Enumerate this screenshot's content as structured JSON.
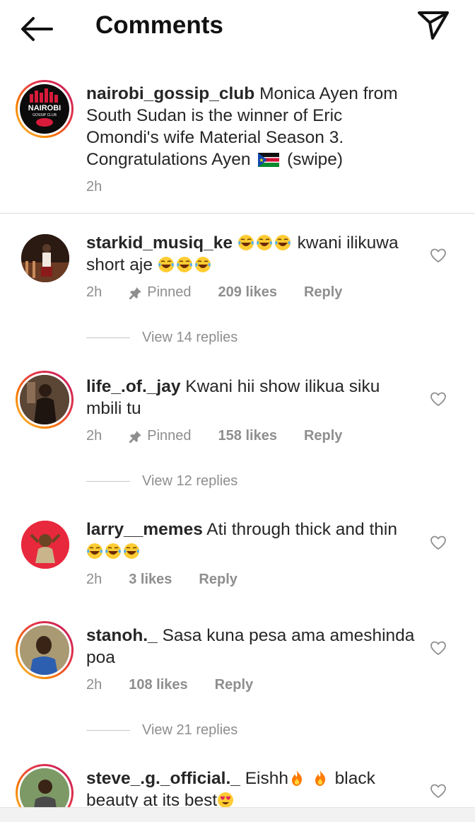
{
  "header": {
    "title": "Comments"
  },
  "caption": {
    "username": "nairobi_gossip_club",
    "text_before_flag": "Monica Ayen from South Sudan is the winner of Eric Omondi's wife Material Season 3. Congratulations Ayen",
    "text_after_flag": "(swipe)",
    "time": "2h",
    "avatar_text": "NAIROBI",
    "avatar_subtext": "GOSSIP CLUB"
  },
  "comments": [
    {
      "username": "starkid_musiq_ke",
      "text": "kwani ilikuwa short aje",
      "time": "2h",
      "pinned": "Pinned",
      "likes": "209 likes",
      "reply": "Reply",
      "view_replies": "View 14 replies"
    },
    {
      "username": "life_.of._jay",
      "text": "Kwani hii show ilikua siku mbili tu",
      "time": "2h",
      "pinned": "Pinned",
      "likes": "158 likes",
      "reply": "Reply",
      "view_replies": "View 12 replies"
    },
    {
      "username": "larry__memes",
      "text": "Ati through thick and thin",
      "time": "2h",
      "likes": "3 likes",
      "reply": "Reply"
    },
    {
      "username": "stanoh._",
      "text": "Sasa kuna pesa ama ameshinda poa",
      "time": "2h",
      "likes": "108 likes",
      "reply": "Reply",
      "view_replies": "View 21 replies"
    },
    {
      "username": "steve_.g._official._",
      "text_a": "Eishh",
      "text_b": "black beauty at its best"
    }
  ],
  "icons": {
    "back": "arrow-left-icon",
    "send": "paper-plane-icon",
    "heart": "heart-outline-icon",
    "pin": "pin-icon",
    "emoji_laugh": "face-with-tears-of-joy",
    "emoji_fire": "fire",
    "emoji_heart_eyes": "heart-eyes",
    "flag": "south-sudan-flag"
  },
  "colors": {
    "ring_gradient_start": "#f9c74f",
    "ring_gradient_end": "#c2185b",
    "meta_gray": "#8e8e8e"
  }
}
